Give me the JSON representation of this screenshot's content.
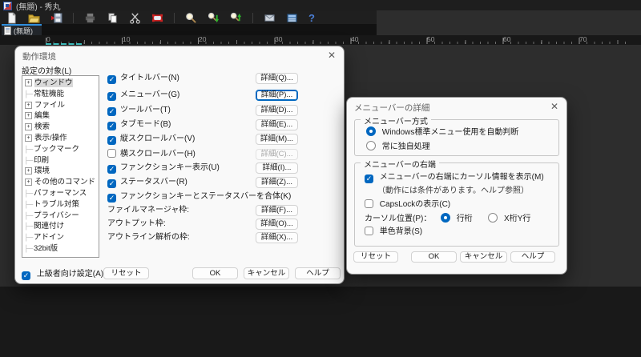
{
  "window": {
    "title": "(無題) - 秀丸",
    "tab_label": "(無題)"
  },
  "toolbar": {
    "icons": [
      "new-file",
      "open-folder",
      "save",
      "print",
      "copy",
      "cut",
      "paste-box",
      "find",
      "find-next",
      "find-previous",
      "mail",
      "window-list",
      "help"
    ]
  },
  "ruler": {
    "collapse": "«",
    "marks": [
      "0",
      "10",
      "20",
      "30",
      "40",
      "50",
      "60",
      "70"
    ]
  },
  "dialog_main": {
    "title": "動作環境",
    "tree_label": "設定の対象(L)",
    "tree": [
      {
        "label": "ウィンドウ",
        "branch": true,
        "selected": true
      },
      {
        "label": "常駐機能",
        "branch": false
      },
      {
        "label": "ファイル",
        "branch": true
      },
      {
        "label": "編集",
        "branch": true
      },
      {
        "label": "検索",
        "branch": true
      },
      {
        "label": "表示/操作",
        "branch": true
      },
      {
        "label": "ブックマーク",
        "branch": false
      },
      {
        "label": "印刷",
        "branch": false
      },
      {
        "label": "環境",
        "branch": true
      },
      {
        "label": "その他のコマンド",
        "branch": true
      },
      {
        "label": "パフォーマンス",
        "branch": false
      },
      {
        "label": "トラブル対策",
        "branch": false
      },
      {
        "label": "プライバシー",
        "branch": false
      },
      {
        "label": "関連付け",
        "branch": false
      },
      {
        "label": "アドイン",
        "branch": false
      },
      {
        "label": "32bit版",
        "branch": false
      }
    ],
    "rows": [
      {
        "label": "タイトルバー(N)",
        "checked": true,
        "button": "詳細(Q)..."
      },
      {
        "label": "メニューバー(G)",
        "checked": true,
        "button": "詳細(P)...",
        "focused": true
      },
      {
        "label": "ツールバー(T)",
        "checked": true,
        "button": "詳細(D)..."
      },
      {
        "label": "タブモード(B)",
        "checked": true,
        "button": "詳細(E)..."
      },
      {
        "label": "縦スクロールバー(V)",
        "checked": true,
        "button": "詳細(M)..."
      },
      {
        "label": "横スクロールバー(H)",
        "checked": false,
        "button": "詳細(C)...",
        "button_disabled": true
      },
      {
        "label": "ファンクションキー表示(U)",
        "checked": true,
        "button": "詳細(I)..."
      },
      {
        "label": "ステータスバー(R)",
        "checked": true,
        "button": "詳細(Z)..."
      },
      {
        "label": "ファンクションキーとステータスバーを合体(K)",
        "checked": true
      },
      {
        "label": "ファイルマネージャ枠:",
        "plain": true,
        "button": "詳細(F)..."
      },
      {
        "label": "アウトプット枠:",
        "plain": true,
        "button": "詳細(O)..."
      },
      {
        "label": "アウトライン解析の枠:",
        "plain": true,
        "button": "詳細(X)..."
      }
    ],
    "advanced_label": "上級者向け設定(A)",
    "advanced_checked": true,
    "buttons": {
      "reset": "リセット",
      "ok": "OK",
      "cancel": "キャンセル",
      "help": "ヘルプ"
    }
  },
  "dialog_menu": {
    "title": "メニューバーの詳細",
    "group_method": {
      "title": "メニューバー方式",
      "radio_auto": "Windows標準メニュー使用を自動判断",
      "radio_auto_selected": true,
      "radio_own": "常に独自処理",
      "radio_own_selected": false
    },
    "group_right": {
      "title": "メニューバーの右端",
      "check_cursor_info": "メニューバーの右端にカーソル情報を表示(M)",
      "check_cursor_info_checked": true,
      "note": "（動作には条件があります。ヘルプ参照）",
      "check_capslock": "CapsLockの表示(C)",
      "check_capslock_checked": false,
      "cursor_pos_label": "カーソル位置(P)：",
      "cursor_pos_option1": "行桁",
      "cursor_pos_option1_selected": true,
      "cursor_pos_option2": "X桁Y行",
      "cursor_pos_option2_selected": false,
      "check_mono_bg": "単色背景(S)",
      "check_mono_bg_checked": false
    },
    "buttons": {
      "reset": "リセット",
      "ok": "OK",
      "cancel": "キャンセル",
      "help": "ヘルプ"
    }
  },
  "colors": {
    "accent": "#0067c0",
    "tab_accent": "#2f8fdd",
    "titlebar_bg": "#1e1e1e",
    "editor_bg": "#2d2d2d",
    "dialog_bg": "#f9f9f9",
    "ruler_tabstop": "#3fc8c8"
  }
}
